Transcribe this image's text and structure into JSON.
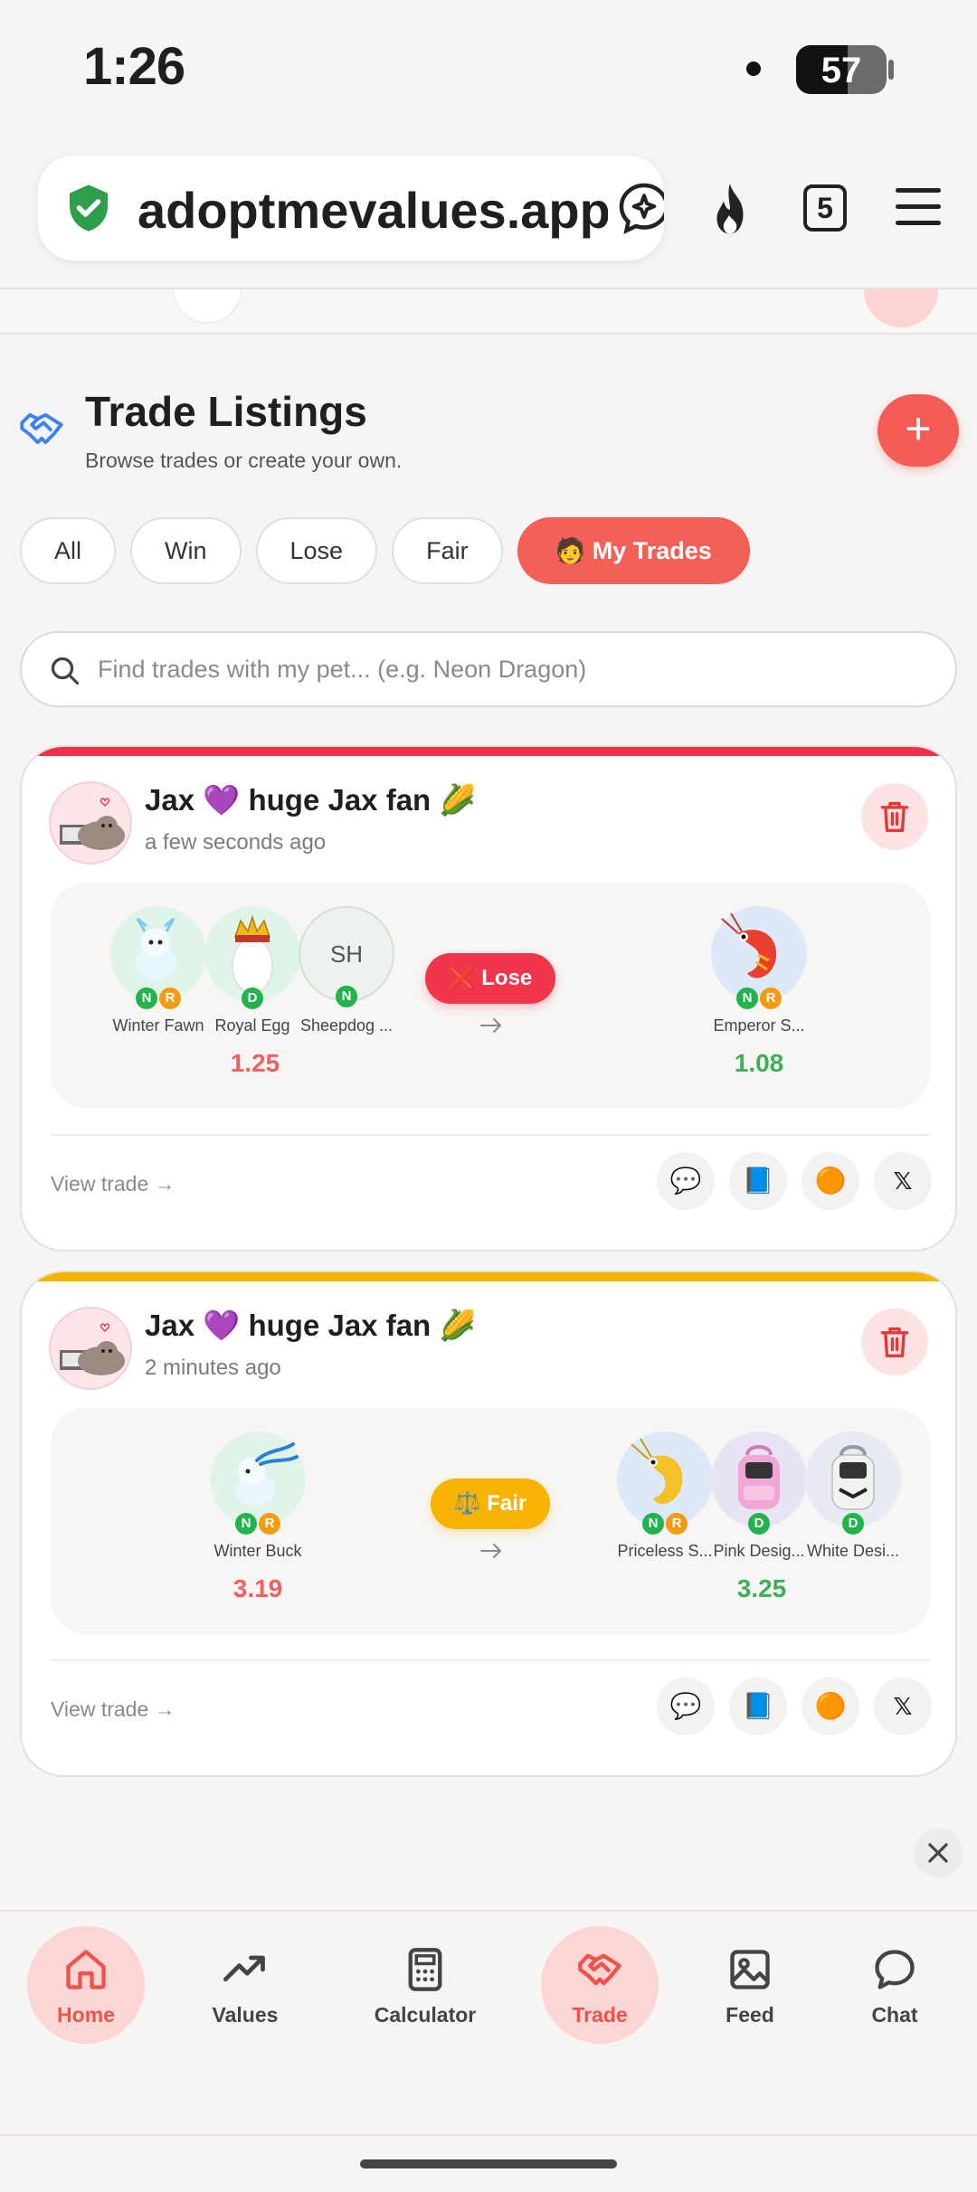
{
  "status": {
    "time": "1:26",
    "battery": "57"
  },
  "browser": {
    "url": "adoptmevalues.app",
    "tab_count": "5"
  },
  "header": {
    "title": "Trade Listings",
    "subtitle": "Browse trades or create your own.",
    "add_label": "+"
  },
  "filters": [
    "All",
    "Win",
    "Lose",
    "Fair",
    "🧑 My Trades"
  ],
  "search": {
    "placeholder": "Find trades with my pet... (e.g. Neon Dragon)"
  },
  "trades": [
    {
      "user": "Jax 💜 huge Jax fan 🌽",
      "time": "a few seconds ago",
      "accent": "#f2304a",
      "verdict": "❌ Lose",
      "give": [
        {
          "initials": "",
          "name": "Winter Fawn",
          "badges": [
            "N",
            "R"
          ]
        },
        {
          "initials": "",
          "name": "Royal Egg",
          "badges": [
            "D"
          ]
        },
        {
          "initials": "SH",
          "name": "Sheepdog ...",
          "badges": [
            "N"
          ]
        }
      ],
      "give_total": "1.25",
      "get": [
        {
          "initials": "",
          "name": "Emperor S...",
          "badges": [
            "N",
            "R"
          ]
        }
      ],
      "get_total": "1.08",
      "view_label": "View trade →"
    },
    {
      "user": "Jax 💜 huge Jax fan 🌽",
      "time": "2 minutes ago",
      "accent": "#f5b400",
      "verdict": "⚖️ Fair",
      "give": [
        {
          "initials": "",
          "name": "Winter Buck",
          "badges": [
            "N",
            "R"
          ]
        }
      ],
      "give_total": "3.19",
      "get": [
        {
          "initials": "",
          "name": "Priceless S...",
          "badges": [
            "N",
            "R"
          ]
        },
        {
          "initials": "",
          "name": "Pink Desig...",
          "badges": [
            "D"
          ]
        },
        {
          "initials": "",
          "name": "White Desi...",
          "badges": [
            "D"
          ]
        }
      ],
      "get_total": "3.25",
      "view_label": "View trade →"
    }
  ],
  "share_icons": [
    "💬",
    "📘",
    "🟠",
    "𝕏"
  ],
  "nav": [
    {
      "label": "Home",
      "icon": "home-icon",
      "active": true
    },
    {
      "label": "Values",
      "icon": "trending-icon",
      "active": false
    },
    {
      "label": "Calculator",
      "icon": "calculator-icon",
      "active": false
    },
    {
      "label": "Trade",
      "icon": "handshake-icon",
      "active": true
    },
    {
      "label": "Feed",
      "icon": "image-icon",
      "active": false
    },
    {
      "label": "Chat",
      "icon": "chat-icon",
      "active": false
    }
  ]
}
